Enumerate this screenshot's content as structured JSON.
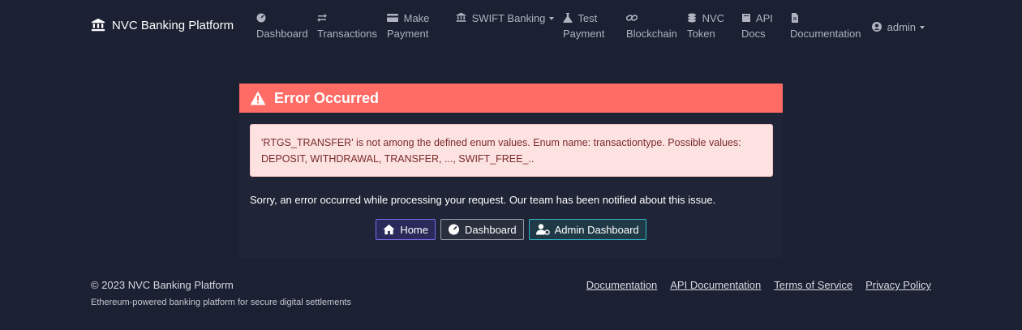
{
  "navbar": {
    "brand": "NVC Banking Platform",
    "items": [
      {
        "l1": "",
        "l2": "Dashboard",
        "icon": "tachometer-icon"
      },
      {
        "l1": "",
        "l2": "Transactions",
        "icon": "exchange-icon"
      },
      {
        "l1": "Make",
        "l2": "Payment",
        "icon": "credit-card-icon"
      },
      {
        "l1": "SWIFT Banking",
        "l2": "",
        "icon": "bank-icon"
      },
      {
        "l1": "Test",
        "l2": "Payment",
        "icon": "flask-icon"
      },
      {
        "l1": "",
        "l2": "Blockchain",
        "icon": "link-icon"
      },
      {
        "l1": "NVC",
        "l2": "Token",
        "icon": "coins-icon"
      },
      {
        "l1": "API",
        "l2": "Docs",
        "icon": "book-icon"
      },
      {
        "l1": "",
        "l2": "Documentation",
        "icon": "file-icon"
      },
      {
        "l1": "admin",
        "l2": "",
        "icon": "user-circle-icon"
      }
    ]
  },
  "error": {
    "title": "Error Occurred",
    "detail": "'RTGS_TRANSFER' is not among the defined enum values. Enum name: transactiontype. Possible values: DEPOSIT, WITHDRAWAL, TRANSFER, ..., SWIFT_FREE_..",
    "message": "Sorry, an error occurred while processing your request. Our team has been notified about this issue.",
    "buttons": {
      "home": "Home",
      "dashboard": "Dashboard",
      "admin": "Admin Dashboard"
    }
  },
  "footer": {
    "copyright": "© 2023 NVC Banking Platform",
    "tagline": "Ethereum-powered banking platform for secure digital settlements",
    "links": [
      "Documentation",
      "API Documentation",
      "Terms of Service",
      "Privacy Policy"
    ]
  },
  "colors": {
    "background": "#1b2032",
    "error_header": "#ff6b65",
    "alert_bg": "#fde2e2"
  }
}
